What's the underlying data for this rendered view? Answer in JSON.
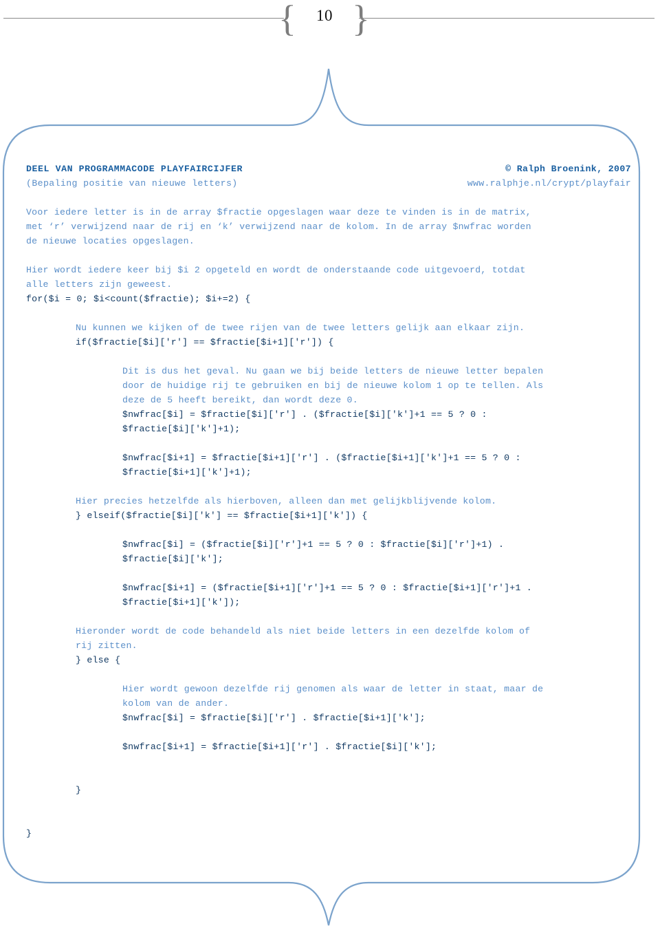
{
  "header": {
    "page_number": "10",
    "brace_left": "{",
    "brace_right": "}"
  },
  "document": {
    "title": "DEEL VAN PROGRAMMACODE PLAYFAIRCIJFER",
    "subtitle": "(Bepaling positie van nieuwe letters)",
    "copyright": "© Ralph Broenink, 2007",
    "website": "www.ralphje.nl/crypt/playfair"
  },
  "colors": {
    "frame": "#7ba3cc",
    "rule": "#8a8a8a",
    "title": "#1a5fa0",
    "comment": "#5b8fc9",
    "code": "#123a63",
    "page_number": "#111111"
  },
  "listing": [
    {
      "kind": "comment",
      "indent": 0,
      "text": "Voor iedere letter is in de array $fractie opgeslagen waar deze te vinden is in de matrix,"
    },
    {
      "kind": "comment",
      "indent": 0,
      "text": "met ‘r’ verwijzend naar de rij en ‘k’ verwijzend naar de kolom. In de array $nwfrac worden"
    },
    {
      "kind": "comment",
      "indent": 0,
      "text": "de nieuwe locaties opgeslagen."
    },
    {
      "kind": "blank",
      "indent": 0,
      "text": ""
    },
    {
      "kind": "comment",
      "indent": 0,
      "text": "Hier wordt iedere keer bij $i 2 opgeteld en wordt de onderstaande code uitgevoerd, totdat"
    },
    {
      "kind": "comment",
      "indent": 0,
      "text": "alle letters zijn geweest."
    },
    {
      "kind": "code",
      "indent": 0,
      "text": "for($i = 0; $i<count($fractie); $i+=2) {"
    },
    {
      "kind": "blank",
      "indent": 0,
      "text": ""
    },
    {
      "kind": "comment",
      "indent": 1,
      "text": "Nu kunnen we kijken of de twee rijen van de twee letters gelijk aan elkaar zijn."
    },
    {
      "kind": "code",
      "indent": 1,
      "text": "if($fractie[$i]['r'] == $fractie[$i+1]['r']) {"
    },
    {
      "kind": "blank",
      "indent": 0,
      "text": ""
    },
    {
      "kind": "comment",
      "indent": 2,
      "text": "Dit is dus het geval. Nu gaan we bij beide letters de nieuwe letter bepalen"
    },
    {
      "kind": "comment",
      "indent": 2,
      "text": "door de huidige rij te gebruiken en bij de nieuwe kolom 1 op te tellen. Als"
    },
    {
      "kind": "comment",
      "indent": 2,
      "text": "deze de 5 heeft bereikt, dan wordt deze 0."
    },
    {
      "kind": "code",
      "indent": 2,
      "text": "$nwfrac[$i] = $fractie[$i]['r'] . ($fractie[$i]['k']+1 == 5 ? 0 :"
    },
    {
      "kind": "code",
      "indent": 2,
      "text": "$fractie[$i]['k']+1);"
    },
    {
      "kind": "blank",
      "indent": 0,
      "text": ""
    },
    {
      "kind": "code",
      "indent": 2,
      "text": "$nwfrac[$i+1] = $fractie[$i+1]['r'] . ($fractie[$i+1]['k']+1 == 5 ? 0 :"
    },
    {
      "kind": "code",
      "indent": 2,
      "text": "$fractie[$i+1]['k']+1);"
    },
    {
      "kind": "blank",
      "indent": 0,
      "text": ""
    },
    {
      "kind": "comment",
      "indent": 1,
      "text": "Hier precies hetzelfde als hierboven, alleen dan met gelijkblijvende kolom."
    },
    {
      "kind": "code",
      "indent": 1,
      "text": "} elseif($fractie[$i]['k'] == $fractie[$i+1]['k']) {"
    },
    {
      "kind": "blank",
      "indent": 0,
      "text": ""
    },
    {
      "kind": "code",
      "indent": 2,
      "text": "$nwfrac[$i] = ($fractie[$i]['r']+1 == 5 ? 0 : $fractie[$i]['r']+1) ."
    },
    {
      "kind": "code",
      "indent": 2,
      "text": "$fractie[$i]['k'];"
    },
    {
      "kind": "blank",
      "indent": 0,
      "text": ""
    },
    {
      "kind": "code",
      "indent": 2,
      "text": "$nwfrac[$i+1] = ($fractie[$i+1]['r']+1 == 5 ? 0 : $fractie[$i+1]['r']+1 ."
    },
    {
      "kind": "code",
      "indent": 2,
      "text": "$fractie[$i+1]['k']);"
    },
    {
      "kind": "blank",
      "indent": 0,
      "text": ""
    },
    {
      "kind": "comment",
      "indent": 1,
      "text": "Hieronder wordt de code behandeld als niet beide letters in een dezelfde kolom of"
    },
    {
      "kind": "comment",
      "indent": 1,
      "text": "rij zitten."
    },
    {
      "kind": "code",
      "indent": 1,
      "text": "} else {"
    },
    {
      "kind": "blank",
      "indent": 0,
      "text": ""
    },
    {
      "kind": "comment",
      "indent": 2,
      "text": "Hier wordt gewoon dezelfde rij genomen als waar de letter in staat, maar de"
    },
    {
      "kind": "comment",
      "indent": 2,
      "text": "kolom van de ander."
    },
    {
      "kind": "code",
      "indent": 2,
      "text": "$nwfrac[$i] = $fractie[$i]['r'] . $fractie[$i+1]['k'];"
    },
    {
      "kind": "blank",
      "indent": 0,
      "text": ""
    },
    {
      "kind": "code",
      "indent": 2,
      "text": "$nwfrac[$i+1] = $fractie[$i+1]['r'] . $fractie[$i]['k'];"
    },
    {
      "kind": "blank",
      "indent": 0,
      "text": ""
    },
    {
      "kind": "blank",
      "indent": 0,
      "text": ""
    },
    {
      "kind": "code",
      "indent": 1,
      "text": "}"
    },
    {
      "kind": "blank",
      "indent": 0,
      "text": ""
    },
    {
      "kind": "blank",
      "indent": 0,
      "text": ""
    },
    {
      "kind": "code",
      "indent": 0,
      "text": "}"
    }
  ]
}
